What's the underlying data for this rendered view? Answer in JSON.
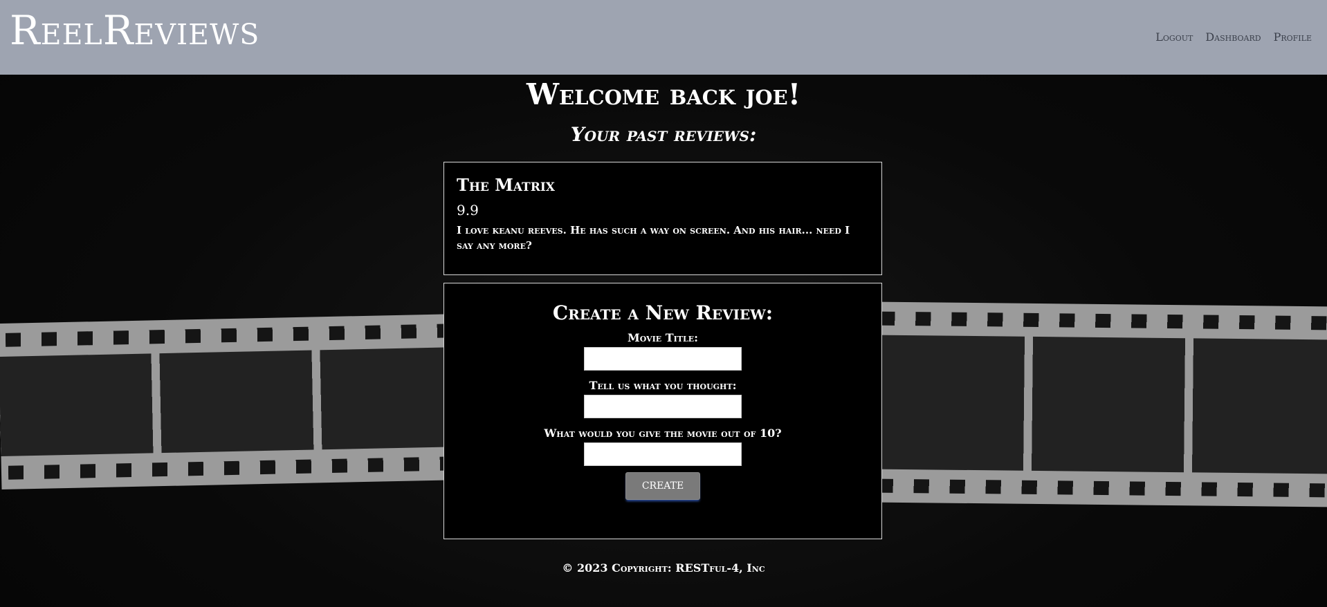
{
  "navbar": {
    "brand": "ReelReviews",
    "links": [
      "Logout",
      "Dashboard",
      "Profile"
    ]
  },
  "main": {
    "welcome": "Welcome back joe!",
    "past_heading": "Your past reviews:",
    "reviews": [
      {
        "title": "The Matrix",
        "rating": "9.9",
        "text": "I love keanu reeves. He has such a way on screen. And his hair... need I say any more?"
      }
    ],
    "create_form": {
      "heading": "Create a New Review:",
      "title_label": "Movie Title:",
      "thoughts_label": "Tell us what you thought:",
      "rating_label": "What would you give the movie out of 10?",
      "title_value": "",
      "thoughts_value": "",
      "rating_value": "",
      "submit_label": "CREATE"
    }
  },
  "footer": {
    "copyright": "© 2023 Copyright: RESTful-4, Inc"
  }
}
